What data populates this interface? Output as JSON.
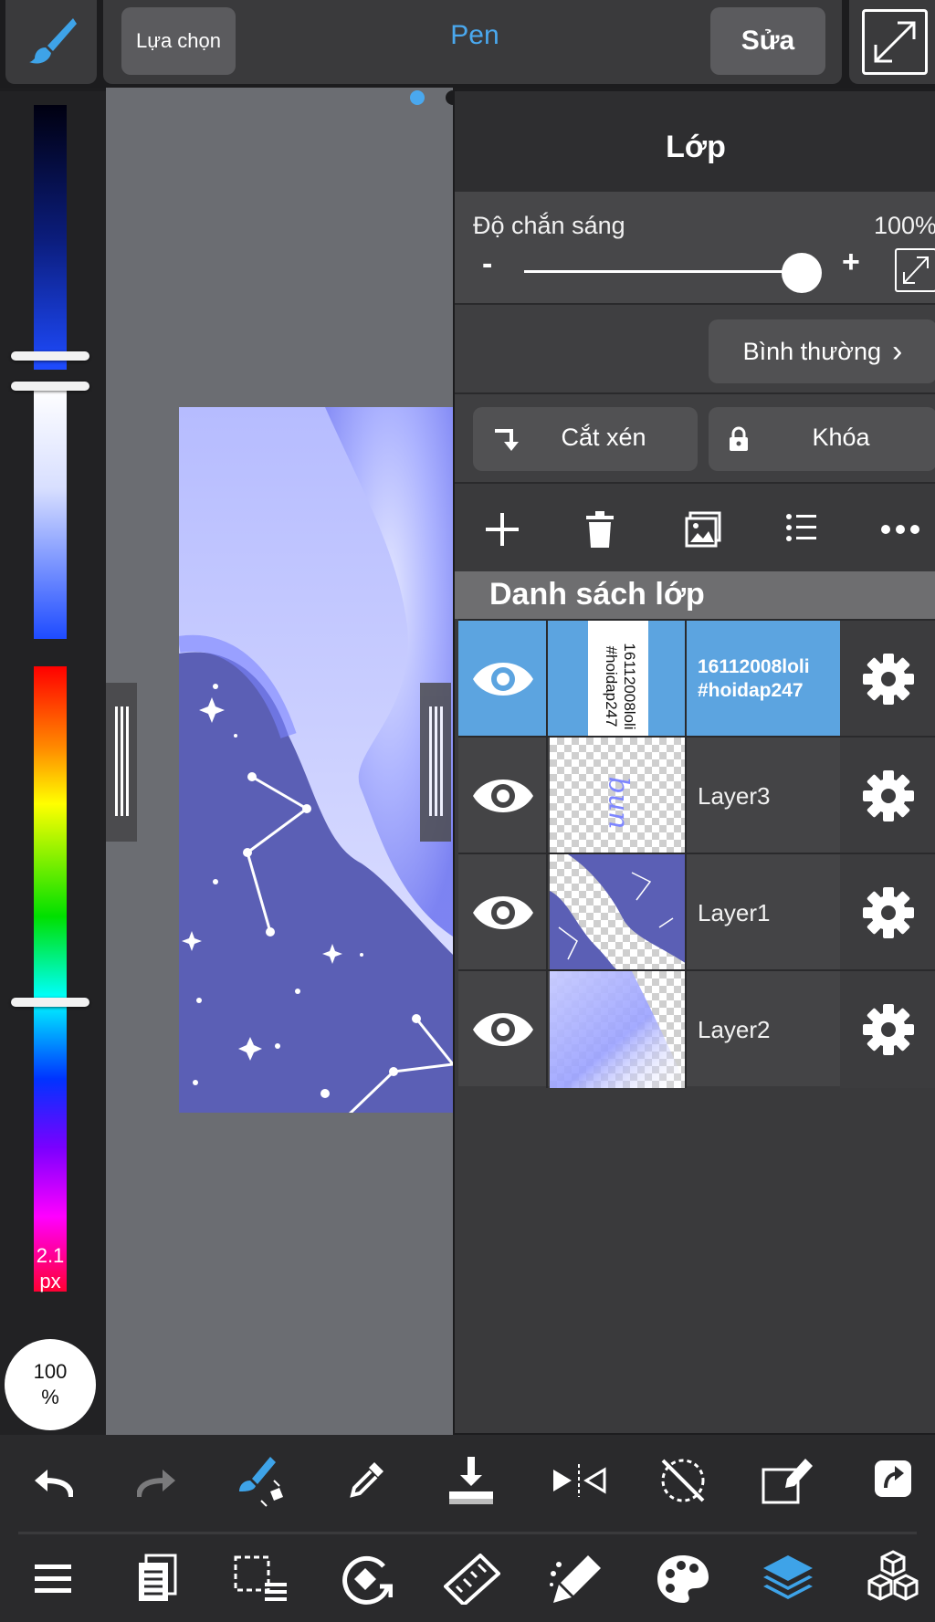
{
  "topbar": {
    "select_label": "Lựa chọn",
    "tool_name": "Pen",
    "edit_label": "Sửa"
  },
  "left_panel": {
    "brush_size": "2.1",
    "brush_unit": "px",
    "opacity_value": "100",
    "opacity_unit": "%"
  },
  "layer_panel": {
    "title": "Lớp",
    "opacity_label": "Độ chắn sáng",
    "opacity_value": "100%",
    "opacity_fraction": 1.0,
    "minus": "-",
    "plus": "+",
    "blend_mode": "Bình thường",
    "clip_label": "Cắt xén",
    "lock_label": "Khóa",
    "list_header": "Danh sách lớp",
    "layers": [
      {
        "name_line1": "16112008loli",
        "name_line2": "#hoidap247",
        "thumb_text_line1": "16112008loli",
        "thumb_text_line2": "#hoidap247",
        "selected": true
      },
      {
        "name": "Layer3",
        "thumb_text": "bun"
      },
      {
        "name": "Layer1"
      },
      {
        "name": "Layer2"
      }
    ]
  },
  "colors": {
    "accent": "#4aa8ee",
    "selected_row": "#5ca4e0",
    "panel_bg": "#3a3a3c",
    "canvas_bg": "#6b6d72",
    "artwork_main": "#5b5fb5"
  }
}
